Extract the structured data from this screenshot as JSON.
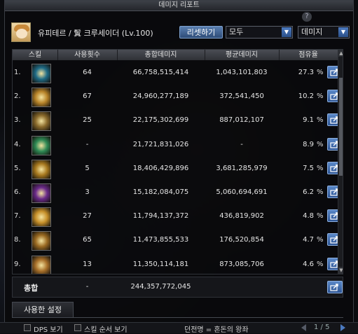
{
  "window": {
    "title": "데미지 리포트"
  },
  "character": {
    "name_label": "유피테르 / 鬒 크루세이더 (Lv.100)"
  },
  "controls": {
    "reset_label": "리셋하기",
    "filter_value": "모두",
    "sort_value": "데미지",
    "help_icon": "?"
  },
  "table": {
    "headers": [
      "스킬",
      "사용횟수",
      "총합데미지",
      "평균데미지",
      "점유율"
    ],
    "percent_sign": "%",
    "rows": [
      {
        "rank": "1.",
        "icon_color": "#1f6b86",
        "uses": "64",
        "total": "66,758,515,414",
        "avg": "1,043,101,803",
        "share": "27.3"
      },
      {
        "rank": "2.",
        "icon_color": "#b9852a",
        "uses": "67",
        "total": "24,960,277,189",
        "avg": "372,541,450",
        "share": "10.2"
      },
      {
        "rank": "3.",
        "icon_color": "#8a6a2c",
        "uses": "25",
        "total": "22,175,302,699",
        "avg": "887,012,107",
        "share": "9.1"
      },
      {
        "rank": "4.",
        "icon_color": "#2f8a55",
        "uses": "-",
        "total": "21,721,831,026",
        "avg": "-",
        "share": "8.9"
      },
      {
        "rank": "5.",
        "icon_color": "#a8791f",
        "uses": "5",
        "total": "18,406,429,896",
        "avg": "3,681,285,979",
        "share": "7.5"
      },
      {
        "rank": "6.",
        "icon_color": "#6a2a8a",
        "uses": "3",
        "total": "15,182,084,075",
        "avg": "5,060,694,691",
        "share": "6.2"
      },
      {
        "rank": "7.",
        "icon_color": "#c7902a",
        "uses": "27",
        "total": "11,794,137,372",
        "avg": "436,819,902",
        "share": "4.8"
      },
      {
        "rank": "8.",
        "icon_color": "#9a6a22",
        "uses": "65",
        "total": "11,473,855,533",
        "avg": "176,520,854",
        "share": "4.7"
      },
      {
        "rank": "9.",
        "icon_color": "#a8702a",
        "uses": "13",
        "total": "11,350,114,181",
        "avg": "873,085,706",
        "share": "4.6"
      }
    ]
  },
  "summary": {
    "label": "총합",
    "uses": "-",
    "total": "244,357,772,045"
  },
  "tabs": {
    "used_settings": "사용한 설정"
  },
  "footer": {
    "dps_label": "DPS 보기",
    "skill_order_label": "스킬 순서 보기",
    "dungeon_label": "던전명 = 혼돈의 왕좌",
    "page": "1 / 5"
  }
}
